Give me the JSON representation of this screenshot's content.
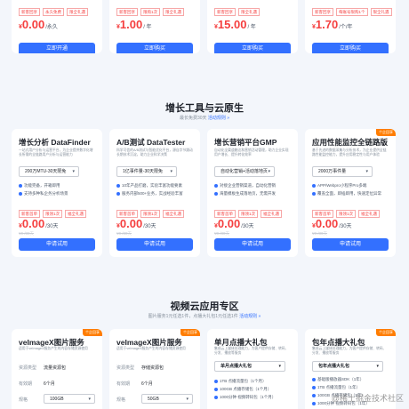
{
  "top_cards": [
    {
      "tags": [
        "新客回享",
        "永久免费",
        "限全礼遇"
      ],
      "price": "0.00",
      "unit": "/永久",
      "button": "立即开通"
    },
    {
      "tags": [
        "新客回享",
        "限购1次",
        "限全礼遇"
      ],
      "price": "1.00",
      "unit": "/ 年",
      "button": "立即购买"
    },
    {
      "tags": [
        "新客回享",
        "限全礼遇"
      ],
      "price": "15.00",
      "unit": "/ 年",
      "button": "立即购买"
    },
    {
      "tags": [
        "新客回享",
        "每账号限购1个",
        "限全礼遇"
      ],
      "price": "1.70",
      "unit": "/个/年",
      "button": "立即购买"
    }
  ],
  "section2": {
    "title": "增长工具与云原生",
    "subtitle": "最长免费30天",
    "link": "活动规则 »",
    "cards": [
      {
        "title": "增长分析 DataFinder",
        "desc": "一站式用户分析与运营平台，为企业提供数字化增长所需的全链路用户分析与运营能力",
        "badge": "",
        "select": "200万MTU-30天限免",
        "features": [
          "功能完备，开箱即用",
          "支持多种私企务分析场景"
        ],
        "tags": [
          "新客首单",
          "限领1次",
          "福全礼遇"
        ],
        "price": "0.00",
        "unit": "/30天",
        "orig": "¥0 /30天",
        "button": "申请试用"
      },
      {
        "title": "A/B测试 DataTester",
        "desc": "科学可信的A/B测试与智能优化平台，源自字节跳动长期技术沉淀，助力企业科学决策",
        "badge": "",
        "select": "1亿事件量-30天限免",
        "features": [
          "10年产品打磨，实验丰富功能要素",
          "服务内部500+业务，实战经验丰富"
        ],
        "tags": [
          "新客首单",
          "限领1次",
          "福全礼遇"
        ],
        "price": "0.00",
        "unit": "/30天",
        "orig": "¥0 /30天",
        "button": "申请试用"
      },
      {
        "title": "增长营销平台GMP",
        "desc": "自动化全渠道触达和营销活动管理，助力企业实现用户增长、提升转化效率",
        "badge": "",
        "select": "自动化营销+活动落地页",
        "features": [
          "对接企业营销渠道，自动化营销",
          "海量模板生成落地页，无需开发"
        ],
        "tags": [
          "新客首单",
          "限领1次",
          "福全礼遇"
        ],
        "price": "0.00",
        "unit": "/30天",
        "orig": "¥0 /30天",
        "button": "申请试用"
      },
      {
        "title": "应用性能监控全链路版",
        "desc": "基于先进的数据采集与分析技术，为企业提供全链路性能监控能力，提升应用稳定性与用户体验",
        "badge": "个企回享",
        "select": "2000万事件量",
        "features": [
          "APP/Webpro小程序Pro多端",
          "覆盖全面，即插即用，快速定位异常"
        ],
        "tags": [
          "新客首单",
          "限领1次",
          "福全礼遇"
        ],
        "price": "0.00",
        "unit": "/30天",
        "orig": "¥0 /30天",
        "button": "申请试用"
      }
    ]
  },
  "section3": {
    "title": "视频云应用专区",
    "subtitle": "图片服务1元任选1件，点播大礼包1元任选1件",
    "link": "活动规则 »",
    "cards": [
      {
        "title": "veImageX图片服务",
        "desc": "适用于veImageX服务产生的内容存储资源使用",
        "badge": "个企回享",
        "rows": [
          {
            "k": "资源类型",
            "v": "流量资源包",
            "box": false
          },
          {
            "k": "有效期",
            "v": "6个月",
            "box": false
          },
          {
            "k": "规格",
            "v": "100GB",
            "box": true
          }
        ]
      },
      {
        "title": "veImageX图片服务",
        "desc": "适用于veImageX服务产生的内容存储资源使用",
        "badge": "个企回享",
        "rows": [
          {
            "k": "资源类型",
            "v": "存储资源包",
            "box": false
          },
          {
            "k": "有效期",
            "v": "6个月",
            "box": false
          },
          {
            "k": "规格",
            "v": "50GB",
            "box": true
          }
        ]
      },
      {
        "title": "单月点播大礼包",
        "desc": "集成云上媒体处理能力，为客户提供存储、转码、分发、播放等服务",
        "badge": "",
        "select": "单月点播大礼包",
        "features": [
          "1TB 点播流量包（1个月）",
          "100GB 点播存储包（1个月）",
          "1000分钟 视频转码包（1个月）"
        ]
      },
      {
        "title": "包年点播大礼包",
        "desc": "集成云上媒体处理能力，为客户提供存储、转码、分发、播放等服务",
        "badge": "个企回享",
        "select": "包年点播大礼包",
        "features": [
          "基础版播放器SDK（1年）",
          "1TB 点播流量包（1年）",
          "100GB 点播存储包（1年）",
          "1000分钟 视频转码包（1年）"
        ]
      }
    ]
  },
  "watermark": "@稀土掘金技术社区",
  "colors": {
    "accent": "#3370ff",
    "price": "#f53f3f",
    "badge": "#ff7d00"
  }
}
